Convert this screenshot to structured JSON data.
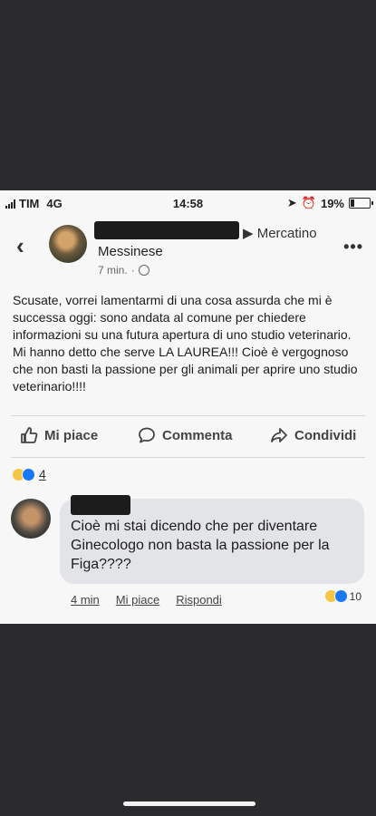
{
  "status_bar": {
    "carrier": "TIM",
    "network": "4G",
    "time": "14:58",
    "battery": "19%"
  },
  "post_header": {
    "group_name": "Mercatino",
    "author_line2": "Messinese",
    "time": "7 min."
  },
  "post_body": "Scusate, vorrei lamentarmi di una cosa assurda che mi è successa oggi: sono andata al comune per chiedere informazioni su una futura apertura di uno studio veterinario. Mi hanno detto che serve LA LAUREA!!! Cioè è vergognoso che non basti la passione per gli animali per aprire uno studio veterinario!!!!",
  "actions": {
    "like": "Mi piace",
    "comment": "Commenta",
    "share": "Condividi"
  },
  "reactions": {
    "count": "4"
  },
  "comment": {
    "text": "Cioè mi stai dicendo che per diventare Ginecologo non basta la passione per la Figa????",
    "time": "4 min",
    "like": "Mi piace",
    "reply": "Rispondi",
    "reaction_count": "10"
  },
  "colors": {
    "background": "#2b2b2d",
    "screenshot_bg": "#f7f7f7",
    "bubble": "#e2e4e8",
    "like_blue": "#1877f2",
    "haha_yellow": "#f6c544"
  }
}
